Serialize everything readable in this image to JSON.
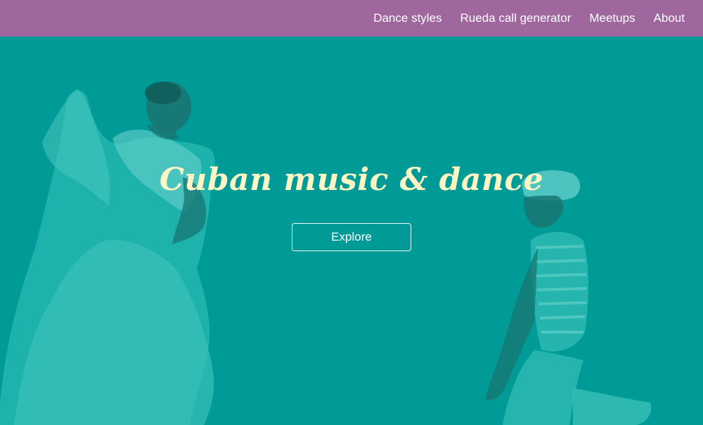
{
  "nav": {
    "items": [
      {
        "label": "Dance styles"
      },
      {
        "label": "Rueda call generator"
      },
      {
        "label": "Meetups"
      },
      {
        "label": "About"
      }
    ]
  },
  "hero": {
    "title": "Cuban music & dance",
    "button_label": "Explore",
    "background_image": "dancers-photo-teal-duotone"
  },
  "colors": {
    "header_bg": "#a0679f",
    "hero_bg": "#009b96",
    "title_color": "#fdf5c4",
    "nav_text": "#ffffff"
  }
}
